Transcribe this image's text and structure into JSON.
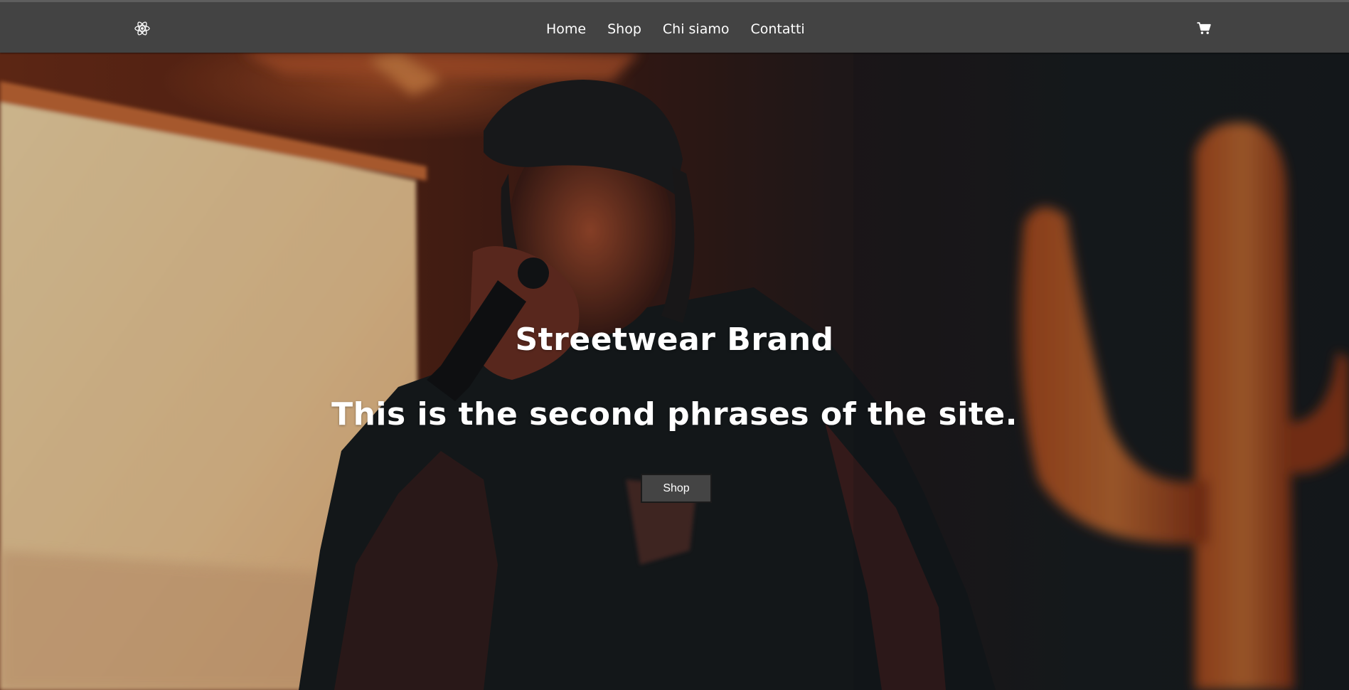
{
  "colors": {
    "navbar_bg": "#434343",
    "nav_text": "#ffffff",
    "button_bg": "#444444",
    "button_border": "#1b1b1b"
  },
  "navbar": {
    "logo_icon": "react-atom-icon",
    "links": [
      {
        "label": "Home"
      },
      {
        "label": "Shop"
      },
      {
        "label": "Chi siamo"
      },
      {
        "label": "Contatti"
      }
    ],
    "cart_icon": "shopping-cart-icon"
  },
  "hero": {
    "title": "Streetwear Brand",
    "subtitle": "This is the second phrases of the site.",
    "button_label": "Shop"
  }
}
